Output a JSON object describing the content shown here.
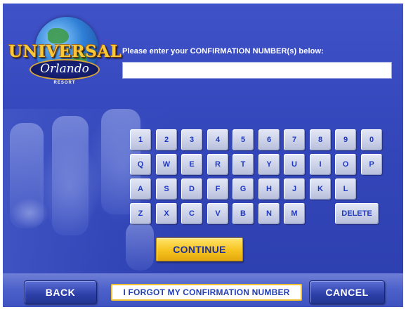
{
  "logo": {
    "word": "UNIVERSAL",
    "script": "Orlando",
    "resort": "RESORT"
  },
  "prompt": {
    "label": "Please enter your CONFIRMATION NUMBER(s) below:",
    "value": "",
    "placeholder": ""
  },
  "keypad": {
    "row1": [
      "1",
      "2",
      "3",
      "4",
      "5",
      "6",
      "7",
      "8",
      "9",
      "0"
    ],
    "row2": [
      "Q",
      "W",
      "E",
      "R",
      "T",
      "Y",
      "U",
      "I",
      "O",
      "P"
    ],
    "row3": [
      "A",
      "S",
      "D",
      "F",
      "G",
      "H",
      "J",
      "K",
      "L"
    ],
    "row4": [
      "Z",
      "X",
      "C",
      "V",
      "B",
      "N",
      "M"
    ],
    "delete": "DELETE"
  },
  "buttons": {
    "continue": "CONTINUE",
    "back": "BACK",
    "forgot": "I FORGOT MY CONFIRMATION NUMBER",
    "cancel": "CANCEL"
  },
  "colors": {
    "background": "#3447bb",
    "key_text": "#1f39c2",
    "continue": "#f6c31f",
    "forgot_border": "#f1c232"
  }
}
